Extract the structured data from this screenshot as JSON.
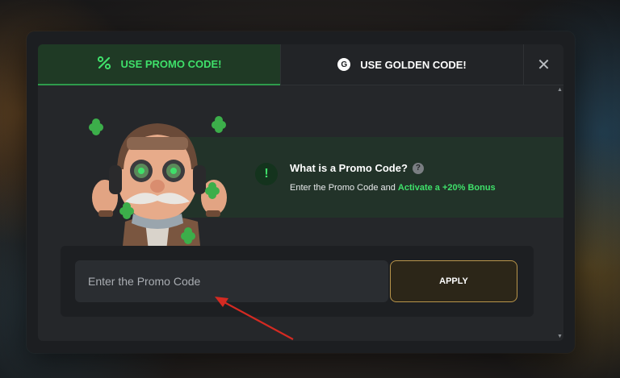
{
  "tabs": {
    "promo_label": "USE PROMO CODE!",
    "promo_icon": "percent-icon",
    "golden_label": "USE GOLDEN CODE!",
    "golden_icon_letter": "G",
    "close_glyph": "✕"
  },
  "info": {
    "icon": "!",
    "title": "What is a Promo Code?",
    "help_glyph": "?",
    "desc_prefix": "Enter the Promo Code and ",
    "desc_highlight": "Activate a +20% Bonus"
  },
  "promo": {
    "placeholder": "Enter the Promo Code",
    "apply_label": "APPLY"
  },
  "colors": {
    "accent_green": "#3fe06a",
    "gold_border": "#b9954a",
    "annotation_red": "#d42a22"
  }
}
